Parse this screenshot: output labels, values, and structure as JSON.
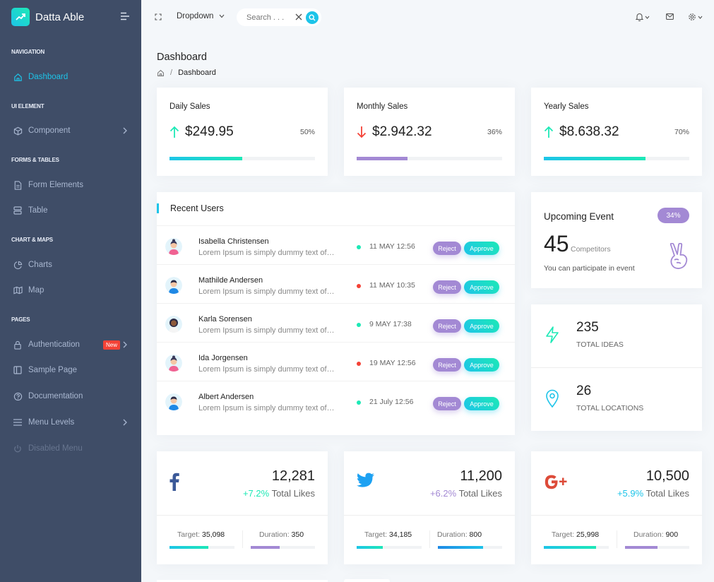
{
  "brand": {
    "name": "Datta Able"
  },
  "sidebar": {
    "captions": [
      "NAVIGATION",
      "UI ELEMENT",
      "FORMS & TABLES",
      "CHART & MAPS",
      "PAGES"
    ],
    "items": [
      {
        "label": "Dashboard"
      },
      {
        "label": "Component"
      },
      {
        "label": "Form Elements"
      },
      {
        "label": "Table"
      },
      {
        "label": "Charts"
      },
      {
        "label": "Map"
      },
      {
        "label": "Authentication",
        "badge": "New"
      },
      {
        "label": "Sample Page"
      },
      {
        "label": "Documentation"
      },
      {
        "label": "Menu Levels"
      },
      {
        "label": "Disabled Menu"
      }
    ]
  },
  "header": {
    "dropdown_label": "Dropdown",
    "search_placeholder": "Search . . ."
  },
  "page": {
    "title": "Dashboard",
    "breadcrumb": "Dashboard"
  },
  "sales": [
    {
      "title": "Daily Sales",
      "value": "$249.95",
      "percent": "50%",
      "progress": 0.5,
      "trend": "up"
    },
    {
      "title": "Monthly Sales",
      "value": "$2.942.32",
      "percent": "36%",
      "progress": 0.35,
      "trend": "down"
    },
    {
      "title": "Yearly Sales",
      "value": "$8.638.32",
      "percent": "70%",
      "progress": 0.7,
      "trend": "up"
    }
  ],
  "recent_users": {
    "title": "Recent Users",
    "reject_label": "Reject",
    "approve_label": "Approve",
    "rows": [
      {
        "name": "Isabella Christensen",
        "text": "Lorem Ipsum is simply dummy text of…",
        "date": "11 MAY 12:56",
        "status": "green"
      },
      {
        "name": "Mathilde Andersen",
        "text": "Lorem Ipsum is simply dummy text of…",
        "date": "11 MAY 10:35",
        "status": "red"
      },
      {
        "name": "Karla Sorensen",
        "text": "Lorem Ipsum is simply dummy text of…",
        "date": "9 MAY 17:38",
        "status": "green"
      },
      {
        "name": "Ida Jorgensen",
        "text": "Lorem Ipsum is simply dummy text of…",
        "date": "19 MAY 12:56",
        "status": "red"
      },
      {
        "name": "Albert Andersen",
        "text": "Lorem Ipsum is simply dummy text of…",
        "date": "21 July 12:56",
        "status": "green"
      }
    ]
  },
  "event": {
    "title": "Upcoming Event",
    "badge": "34%",
    "count": "45",
    "unit": "Competitors",
    "note": "You can participate in event"
  },
  "stats": [
    {
      "value": "235",
      "label": "TOTAL IDEAS"
    },
    {
      "value": "26",
      "label": "TOTAL LOCATIONS"
    }
  ],
  "social": [
    {
      "network": "facebook",
      "count": "12,281",
      "change": "+7.2%",
      "likes_label": "Total Likes",
      "target_label": "Target:",
      "target": "35,098",
      "duration_label": "Duration:",
      "duration": "350",
      "target_progress": 0.6,
      "duration_progress": 0.45
    },
    {
      "network": "twitter",
      "count": "11,200",
      "change": "+6.2%",
      "likes_label": "Total Likes",
      "target_label": "Target:",
      "target": "34,185",
      "duration_label": "Duration:",
      "duration": "800",
      "target_progress": 0.4,
      "duration_progress": 0.7
    },
    {
      "network": "google-plus",
      "count": "10,500",
      "change": "+5.9%",
      "likes_label": "Total Likes",
      "target_label": "Target:",
      "target": "25,998",
      "duration_label": "Duration:",
      "duration": "900",
      "target_progress": 0.8,
      "duration_progress": 0.5
    }
  ],
  "colors": {
    "accent": "#1dc4e9",
    "green": "#1de9b6",
    "purple": "#a389d4",
    "red": "#f44236",
    "sidebar": "#3f4d67"
  }
}
